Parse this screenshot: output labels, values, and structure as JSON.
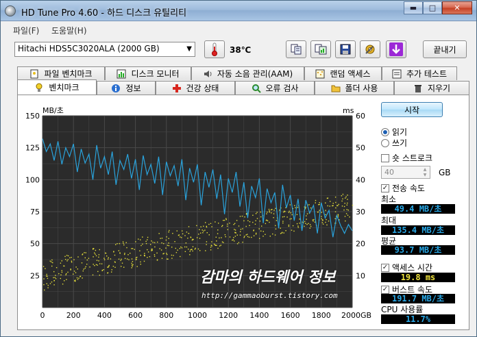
{
  "window": {
    "title": "HD Tune Pro 4.60 - 하드 디스크 유틸리티",
    "min_label": "▬",
    "max_label": "□",
    "close_label": "✕"
  },
  "menu": {
    "file": "파일(F)",
    "help": "도움말(H)"
  },
  "toolbar": {
    "drive": "Hitachi HDS5C3020ALA     (2000 GB)",
    "temperature": "38℃",
    "exit_label": "끝내기",
    "icons": [
      "thermometer-icon",
      "copy-info-icon",
      "copy-screen-icon",
      "save-icon",
      "options-icon",
      "download-icon"
    ]
  },
  "tabs_top": [
    {
      "label": "파일 벤치마크",
      "icon": "file-benchmark-icon"
    },
    {
      "label": "디스크 모니터",
      "icon": "disk-monitor-icon"
    },
    {
      "label": "자동 소음 관리(AAM)",
      "icon": "speaker-icon"
    },
    {
      "label": "랜덤 액세스",
      "icon": "random-access-icon"
    },
    {
      "label": "추가 테스트",
      "icon": "extra-tests-icon"
    }
  ],
  "tabs_bottom": [
    {
      "label": "벤치마크",
      "icon": "lightbulb-icon",
      "active": true
    },
    {
      "label": "정보",
      "icon": "info-icon"
    },
    {
      "label": "건강 상태",
      "icon": "health-cross-icon"
    },
    {
      "label": "오류 검사",
      "icon": "magnifier-icon"
    },
    {
      "label": "폴더 사용",
      "icon": "folder-icon"
    },
    {
      "label": "지우기",
      "icon": "trash-icon"
    }
  ],
  "controls": {
    "start_label": "시작",
    "read_label": "읽기",
    "write_label": "쓰기",
    "short_stroke_label": "숏 스트로크",
    "short_stroke_value": "40",
    "short_stroke_unit": "GB",
    "transfer_rate_label": "전송 속도",
    "min_label": "최소",
    "min_value": "49.4 MB/초",
    "max_label": "최대",
    "max_value": "135.4 MB/초",
    "avg_label": "평균",
    "avg_value": "93.7 MB/초",
    "access_time_label": "액세스 시간",
    "access_time_value": "19.8 ms",
    "burst_rate_label": "버스트 속도",
    "burst_rate_value": "191.7 MB/초",
    "cpu_label": "CPU 사용률",
    "cpu_value": "11.7%"
  },
  "watermark": {
    "title": "감마의 하드웨어 정보",
    "url": "http://gammaoburst.tistory.com"
  },
  "chart_data": {
    "type": "line",
    "y_left_label": "MB/초",
    "y_right_label": "ms",
    "x_ticks": [
      "0",
      "200",
      "400",
      "600",
      "800",
      "1000",
      "1200",
      "1400",
      "1600",
      "1800",
      "2000GB"
    ],
    "y_left_ticks": [
      "150",
      "125",
      "100",
      "75",
      "50",
      "25"
    ],
    "y_right_ticks": [
      "60",
      "50",
      "40",
      "30",
      "20",
      "10"
    ],
    "xlim": [
      0,
      2000
    ],
    "ylim_left": [
      0,
      150
    ],
    "ylim_right": [
      0,
      60
    ],
    "grid": true,
    "colors": {
      "transfer": "#2aa3dc",
      "access": "#e8e23a",
      "background": "#2b2b2b",
      "grid": "#4a4a4a"
    },
    "series": [
      {
        "name": "전송 속도",
        "axis": "left",
        "x": [
          0,
          25,
          50,
          75,
          100,
          125,
          150,
          175,
          200,
          225,
          250,
          275,
          300,
          325,
          350,
          375,
          400,
          425,
          450,
          475,
          500,
          525,
          550,
          575,
          600,
          625,
          650,
          675,
          700,
          725,
          750,
          775,
          800,
          825,
          850,
          875,
          900,
          925,
          950,
          975,
          1000,
          1025,
          1050,
          1075,
          1100,
          1125,
          1150,
          1175,
          1200,
          1225,
          1250,
          1275,
          1300,
          1325,
          1350,
          1375,
          1400,
          1425,
          1450,
          1475,
          1500,
          1525,
          1550,
          1575,
          1600,
          1625,
          1650,
          1675,
          1700,
          1725,
          1750,
          1775,
          1800,
          1825,
          1850,
          1875,
          1900,
          1925,
          1950,
          1975,
          2000
        ],
        "values": [
          132,
          122,
          128,
          115,
          130,
          112,
          125,
          118,
          128,
          106,
          124,
          113,
          120,
          100,
          127,
          109,
          118,
          104,
          122,
          96,
          115,
          108,
          120,
          101,
          116,
          92,
          119,
          104,
          112,
          97,
          118,
          88,
          114,
          103,
          111,
          95,
          116,
          84,
          109,
          98,
          112,
          80,
          106,
          94,
          108,
          85,
          104,
          73,
          101,
          90,
          106,
          79,
          98,
          70,
          95,
          86,
          101,
          66,
          93,
          82,
          90,
          62,
          96,
          78,
          88,
          68,
          85,
          60,
          84,
          74,
          80,
          58,
          82,
          70,
          76,
          55,
          72,
          64,
          58,
          65,
          60
        ]
      },
      {
        "name": "액세스 시간",
        "axis": "right",
        "x": [
          0,
          50,
          100,
          150,
          200,
          250,
          300,
          350,
          400,
          450,
          500,
          550,
          600,
          650,
          700,
          750,
          800,
          850,
          900,
          950,
          1000,
          1050,
          1100,
          1150,
          1200,
          1250,
          1300,
          1350,
          1400,
          1450,
          1500,
          1550,
          1600,
          1650,
          1700,
          1750,
          1800,
          1850,
          1900,
          1950,
          2000
        ],
        "values": [
          9.5,
          10.5,
          11.5,
          12.0,
          12.8,
          13.2,
          14.0,
          14.4,
          15.0,
          15.6,
          16.2,
          16.8,
          17.4,
          17.8,
          18.4,
          19.0,
          19.6,
          20.2,
          20.6,
          21.2,
          21.8,
          22.4,
          22.8,
          23.4,
          24.0,
          24.4,
          25.0,
          25.6,
          26.2,
          26.6,
          27.2,
          27.8,
          28.2,
          28.8,
          29.2,
          29.6,
          30.2,
          30.6,
          31.0,
          31.4,
          32.0
        ]
      }
    ]
  }
}
